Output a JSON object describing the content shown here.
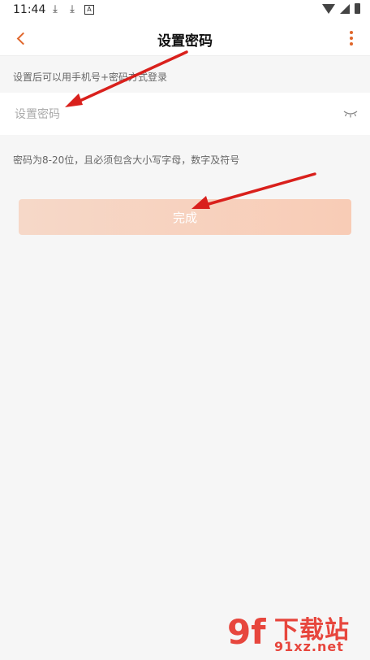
{
  "status_bar": {
    "time": "11:44",
    "notif_icons": [
      "download-icon",
      "download-icon",
      "a-box-icon"
    ],
    "right_icons": [
      "wifi-icon",
      "signal-icon",
      "battery-icon"
    ]
  },
  "nav": {
    "title": "设置密码",
    "accent_color": "#e0662b"
  },
  "hint_top": "设置后可以用手机号+密码方式登录",
  "password_field": {
    "value": "",
    "placeholder": "设置密码"
  },
  "hint_rule": "密码为8-20位，且必须包含大小写字母，数字及符号",
  "done_button": {
    "label": "完成",
    "color_from": "#f6d8c8",
    "color_to": "#f8ccb6"
  },
  "annotation_color": "#d9201c",
  "watermark": {
    "logo": "9f",
    "title": "下载站",
    "url": "91xz.net",
    "color": "#e7463d"
  }
}
